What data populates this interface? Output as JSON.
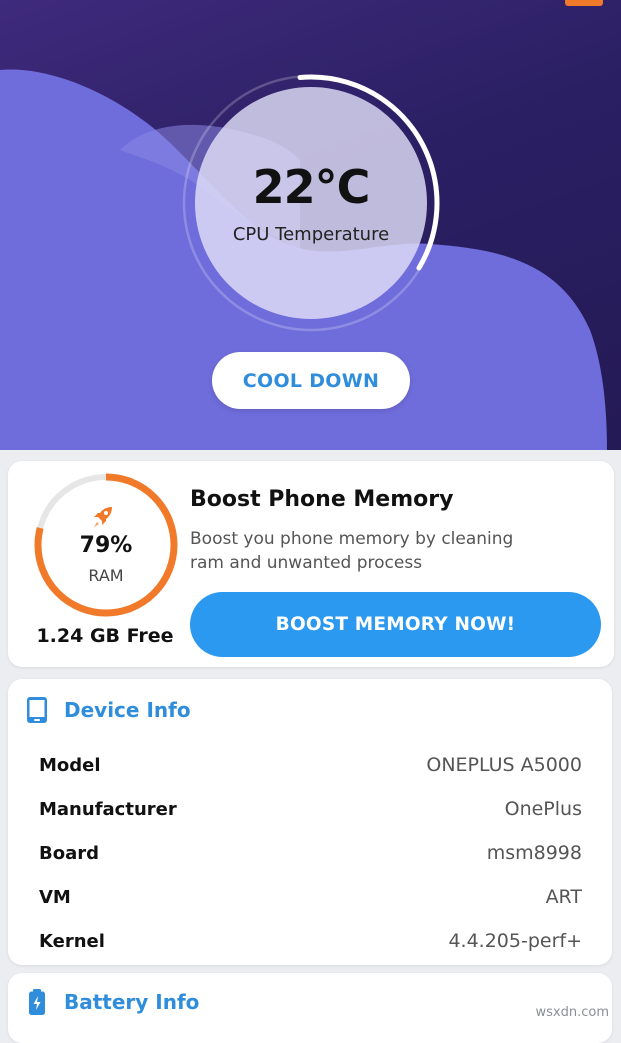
{
  "colors": {
    "accent_blue": "#2f8ddb",
    "button_blue": "#2b99ef",
    "ram_orange": "#f07a2a",
    "hero_dark": "#2a1f63",
    "wave_purple": "#6f6ddb"
  },
  "cpu": {
    "temperature": "22°C",
    "label": "CPU Temperature",
    "gauge_fraction": 0.35
  },
  "cool_down_button": "COOL DOWN",
  "boost": {
    "ram_percent": "79%",
    "ram_fraction": 0.79,
    "ram_label": "RAM",
    "free": "1.24 GB Free",
    "title": "Boost Phone Memory",
    "description_line1": "Boost you phone memory by cleaning",
    "description_line2": "ram and unwanted process",
    "button": "BOOST MEMORY NOW!",
    "icon": "rocket-icon"
  },
  "device_info": {
    "title": "Device Info",
    "icon": "phone-icon",
    "rows": [
      {
        "label": "Model",
        "value": "ONEPLUS A5000"
      },
      {
        "label": "Manufacturer",
        "value": "OnePlus"
      },
      {
        "label": "Board",
        "value": "msm8998"
      },
      {
        "label": "VM",
        "value": "ART"
      },
      {
        "label": "Kernel",
        "value": "4.4.205-perf+"
      }
    ]
  },
  "battery_info": {
    "title": "Battery Info",
    "icon": "battery-icon"
  },
  "watermark": "wsxdn.com"
}
